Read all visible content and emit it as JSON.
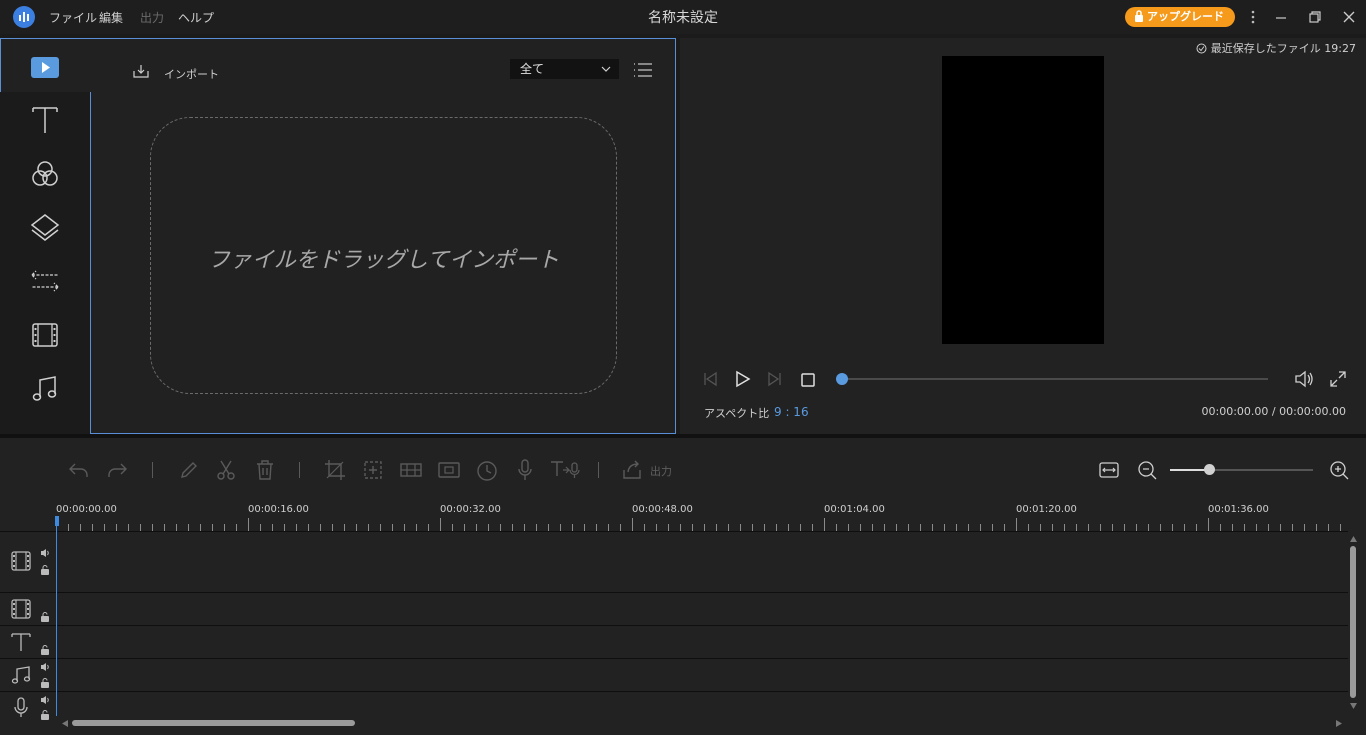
{
  "titlebar": {
    "menus": [
      "ファイル",
      "編集",
      "出力",
      "ヘルプ"
    ],
    "menus_disabled": [
      false,
      false,
      true,
      false
    ],
    "title": "名称未設定",
    "upgrade_label": "アップグレード",
    "window_controls": [
      "more-icon",
      "minimize-icon",
      "restore-icon",
      "close-icon"
    ]
  },
  "media": {
    "rail_icons": [
      "media-icon",
      "text-icon",
      "filter-icon",
      "overlay-icon",
      "transition-icon",
      "element-icon",
      "music-icon"
    ],
    "active_rail": "media-icon",
    "import_label": "インポート",
    "filter_value": "全て",
    "drop_text": "ファイルをドラッグしてインポート"
  },
  "preview": {
    "saved_label": "最近保存したファイル 19:27",
    "aspect_label": "アスペクト比",
    "aspect_value": "9 : 16",
    "time_readout": "00:00:00.00 / 00:00:00.00",
    "progress": 0
  },
  "timeline": {
    "tools": [
      "undo-icon",
      "redo-icon",
      "edit-icon",
      "cut-icon",
      "delete-icon",
      "crop-icon",
      "zoom-crop-icon",
      "mosaic-icon",
      "freeze-icon",
      "speed-icon",
      "voiceover-icon",
      "text-to-speech-icon",
      "export-icon"
    ],
    "export_label": "出力",
    "zoom_level": 0.27,
    "ticks": [
      "00:00:00.00",
      "00:00:16.00",
      "00:00:32.00",
      "00:00:48.00",
      "00:01:04.00",
      "00:01:20.00",
      "00:01:36.00"
    ],
    "tracks": [
      "video-track",
      "overlay-track",
      "text-track",
      "music-track",
      "voice-track"
    ]
  },
  "colors": {
    "accent": "#5a9be0",
    "upgrade": "#f59a1b",
    "panel": "#222222"
  }
}
